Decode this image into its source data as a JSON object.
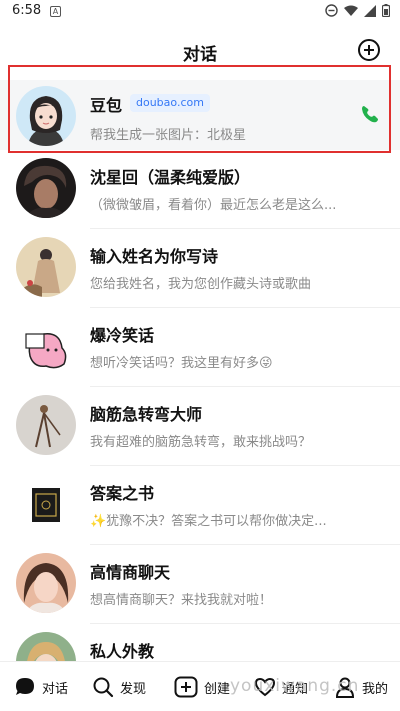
{
  "status_bar": {
    "time": "6:58",
    "notif_letter": "A"
  },
  "header": {
    "title": "对话"
  },
  "chats": [
    {
      "name": "豆包",
      "badge": "doubao.com",
      "preview": "帮我生成一张图片：北极星",
      "has_call": true
    },
    {
      "name": "沈星回（温柔纯爱版）",
      "preview": "（微微皱眉，看着你）最近怎么老是这么..."
    },
    {
      "name": "输入姓名为你写诗",
      "preview": "您给我姓名，我为您创作藏头诗或歌曲"
    },
    {
      "name": "爆冷笑话",
      "preview": "想听冷笑话吗？我这里有好多😜"
    },
    {
      "name": "脑筋急转弯大师",
      "preview": "我有超难的脑筋急转弯，敢来挑战吗？"
    },
    {
      "name": "答案之书",
      "preview": "✨犹豫不决？答案之书可以帮你做决定..."
    },
    {
      "name": "高情商聊天",
      "preview": "想高情商聊天？来找我就对啦！"
    },
    {
      "name": "私人外教",
      "preview": ""
    }
  ],
  "bottom_nav": {
    "chat": "对话",
    "discover": "发现",
    "create": "创建",
    "notify": "通知",
    "me": "我的"
  },
  "watermark": "youxiwang.cn",
  "colors": {
    "highlight": "#e0302f",
    "badge_text": "#3578f6",
    "call_green": "#22b14c"
  }
}
